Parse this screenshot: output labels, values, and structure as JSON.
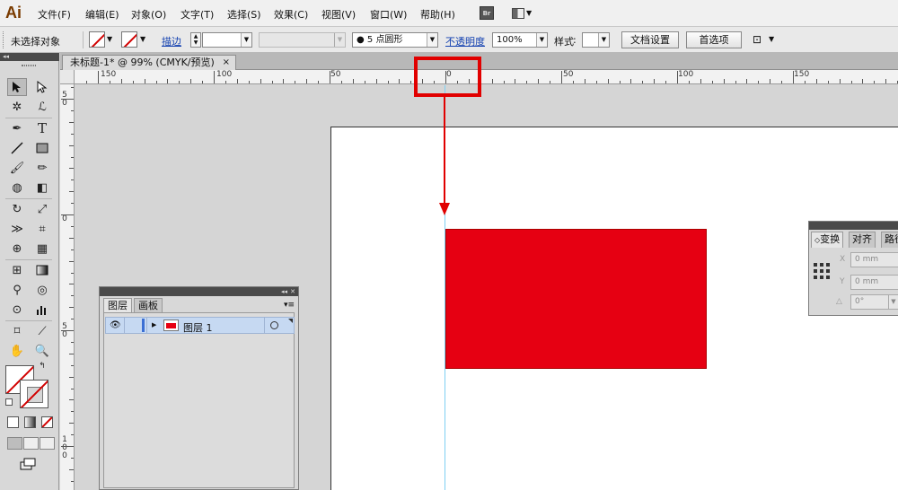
{
  "app": {
    "logo": "Ai"
  },
  "menu": [
    "文件(F)",
    "编辑(E)",
    "对象(O)",
    "文字(T)",
    "选择(S)",
    "效果(C)",
    "视图(V)",
    "窗口(W)",
    "帮助(H)"
  ],
  "bridge_label": "Br",
  "control": {
    "selection_status": "未选择对象",
    "stroke_label": "描边",
    "brush_value": "5 点圆形",
    "opacity_label": "不透明度",
    "opacity_value": "100%",
    "style_label": "样式",
    "doc_setup_button": "文档设置",
    "preferences_button": "首选项"
  },
  "document": {
    "tab_title": "未标题-1* @ 99% (CMYK/预览)",
    "close_glyph": "×"
  },
  "ruler": {
    "h_labels": [
      "150",
      "100",
      "50",
      "0",
      "50",
      "100",
      "150"
    ],
    "v_labels": [
      "5\n0",
      "0",
      "5\n0",
      "1\n0\n0"
    ]
  },
  "layers_panel": {
    "collapse_glyph": "◂◂",
    "tabs": [
      "图层",
      "画板"
    ],
    "menu_glyph": "▾≡",
    "layer": {
      "name": "图层 1",
      "visible_glyph": "👁"
    }
  },
  "transform_panel": {
    "tabs": [
      "变换",
      "对齐",
      "路径"
    ],
    "x_label": "X",
    "y_label": "Y",
    "x_value": "0 mm",
    "y_value": "0 mm",
    "angle_label": "△",
    "angle_value": "0°"
  },
  "colors": {
    "rect_fill": "#e60012",
    "annotation": "#e10000",
    "guide": "#7fd0f2"
  }
}
